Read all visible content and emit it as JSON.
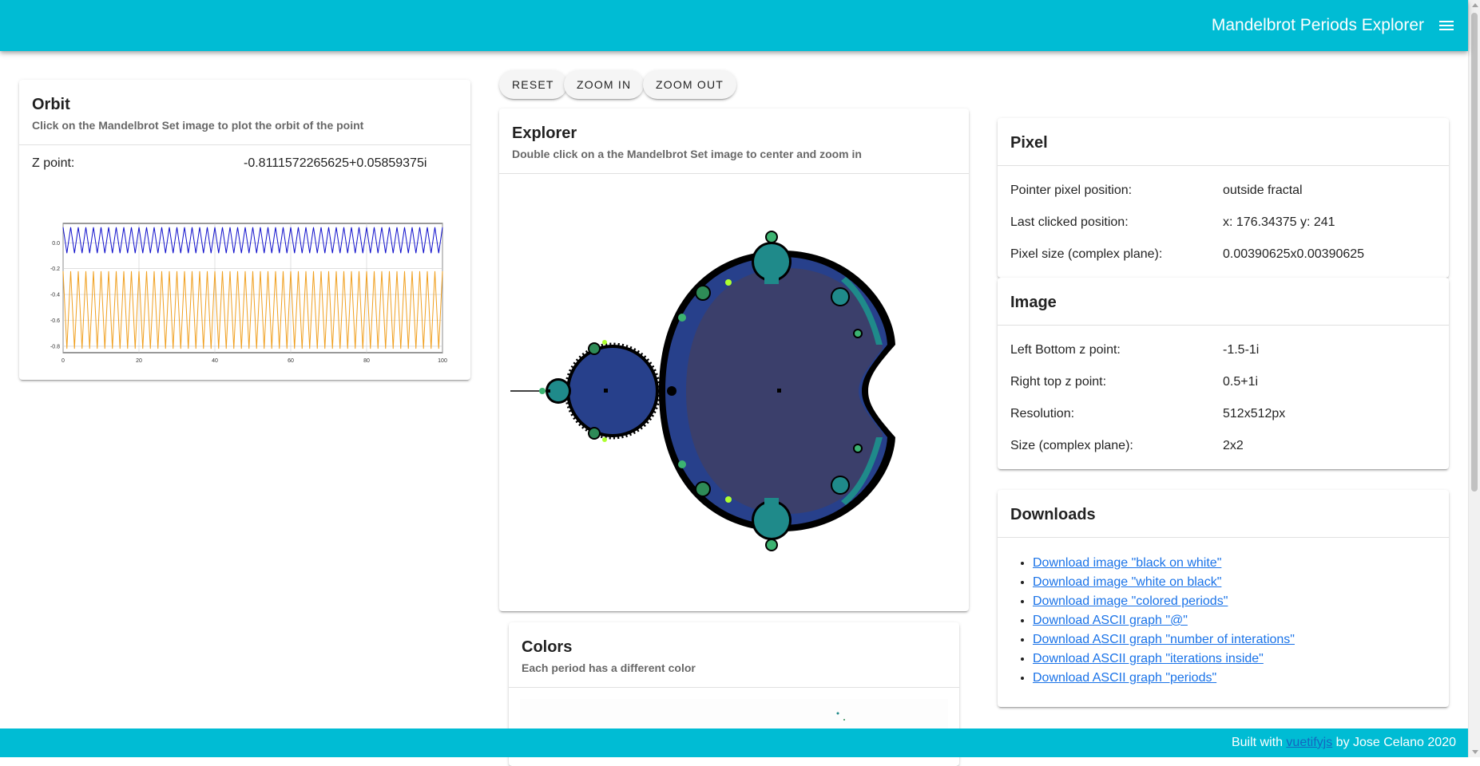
{
  "app": {
    "title": "Mandelbrot Periods Explorer",
    "menu_icon": "hamburger-menu-icon",
    "primary_color": "#00bcd4"
  },
  "toolbar": {
    "reset": "RESET",
    "zoom_in": "ZOOM IN",
    "zoom_out": "ZOOM OUT"
  },
  "orbit": {
    "title": "Orbit",
    "subtitle": "Click on the Mandelbrot Set image to plot the orbit of the point",
    "z_label": "Z point:",
    "z_value": "-0.8111572265625+0.05859375i"
  },
  "chart_data": {
    "type": "line",
    "title": "",
    "xlabel": "",
    "ylabel": "",
    "xlim": [
      0,
      100
    ],
    "ylim": [
      -0.85,
      0.15
    ],
    "x_ticks": [
      "0",
      "20",
      "40",
      "60",
      "80",
      "100"
    ],
    "y_ticks": [
      "0.0",
      "-0.2",
      "-0.4",
      "-0.6",
      "-0.8"
    ],
    "grid": true,
    "legend": "none",
    "series": [
      {
        "color": "#1010cc",
        "description_of_values": "oscillates each step",
        "x": [
          0,
          100
        ],
        "even_value": 0.12,
        "odd_value": -0.08
      },
      {
        "color": "#f0a020",
        "description_of_values": "oscillates each step",
        "x": [
          0,
          100
        ],
        "even_value": -0.22,
        "odd_value": -0.82
      }
    ]
  },
  "explorer": {
    "title": "Explorer",
    "subtitle": "Double click on a the Mandelbrot Set image to center and zoom in",
    "colors": {
      "exterior": "#000000",
      "main_cardioid": "#3b3f6b",
      "period2": "#27408b",
      "period3": "#1f8a8a",
      "period4": "#2e8b57",
      "higher": "#3cb371"
    }
  },
  "colors_card": {
    "title": "Colors",
    "subtitle": "Each period has a different color"
  },
  "pixel": {
    "title": "Pixel",
    "rows": [
      {
        "label": "Pointer pixel position:",
        "value": "outside fractal"
      },
      {
        "label": "Last clicked position:",
        "value": "x: 176.34375 y: 241"
      },
      {
        "label": "Pixel size (complex plane):",
        "value": "0.00390625x0.00390625"
      }
    ]
  },
  "image": {
    "title": "Image",
    "rows": [
      {
        "label": "Left Bottom z point:",
        "value": "-1.5-1i"
      },
      {
        "label": "Right top z point:",
        "value": "0.5+1i"
      },
      {
        "label": "Resolution:",
        "value": "512x512px"
      },
      {
        "label": "Size (complex plane):",
        "value": "2x2"
      }
    ]
  },
  "downloads": {
    "title": "Downloads",
    "links": [
      "Download image \"black on white\"",
      "Download image \"white on black\"",
      "Download image \"colored periods\"",
      "Download ASCII graph \"@\"",
      "Download ASCII graph \"number of interations\"",
      "Download ASCII graph \"iterations inside\"",
      "Download ASCII graph \"periods\""
    ]
  },
  "footer": {
    "prefix": "Built with ",
    "link": "vuetifyjs",
    "suffix": " by Jose Celano 2020"
  }
}
